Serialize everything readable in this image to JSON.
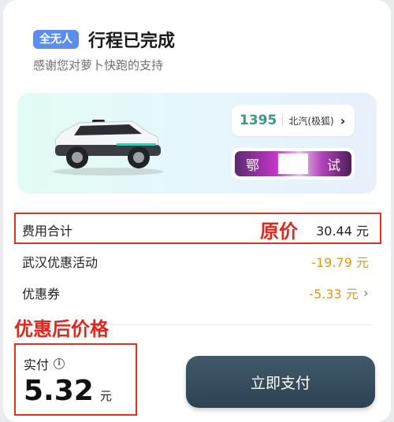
{
  "header": {
    "badge": "全无人",
    "title": "行程已完成",
    "subtitle": "感谢您对萝卜快跑的支持"
  },
  "vehicle": {
    "plate_number": "1395",
    "model": "北汽(极狐)",
    "plate_prefix": "鄂",
    "plate_suffix": "试"
  },
  "fees": {
    "total_label": "费用合计",
    "total_value": "30.44 元",
    "promo_label": "武汉优惠活动",
    "promo_value": "-19.79 元",
    "coupon_label": "优惠券",
    "coupon_value": "-5.33 元"
  },
  "annotations": {
    "original_price": "原价",
    "after_discount": "优惠后价格"
  },
  "payment": {
    "label": "实付",
    "amount": "5.32",
    "unit": "元",
    "button": "立即支付"
  },
  "colors": {
    "promo": "#d79a1c",
    "annotation": "#e3251c",
    "plate_green": "#3a9a86"
  }
}
